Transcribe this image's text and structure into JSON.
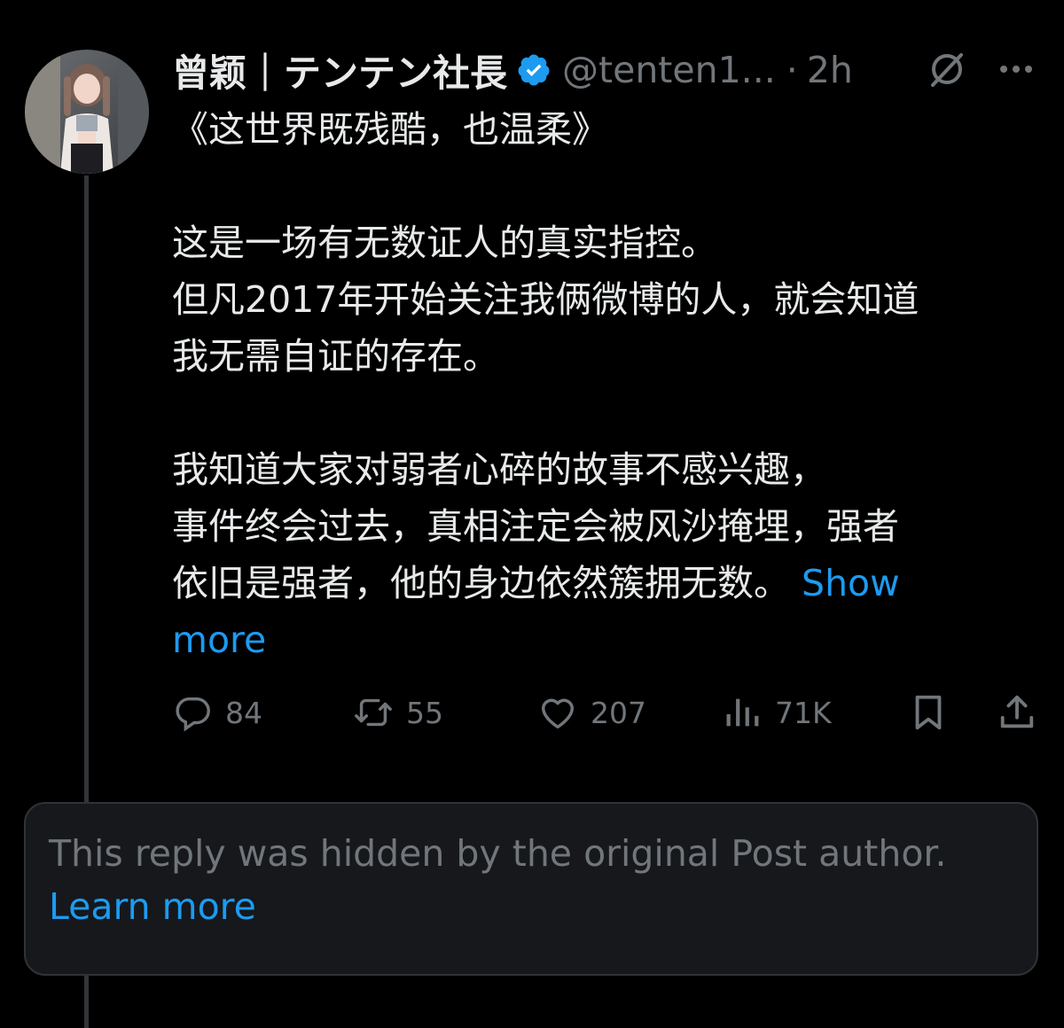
{
  "post": {
    "author": {
      "display_name": "曾颖｜テンテン社長",
      "handle": "@tenten1...",
      "separator": "·",
      "time": "2h",
      "verified": true,
      "avatar": "avatar-photo"
    },
    "body_lines": [
      "《这世界既残酷，也温柔》",
      "",
      "这是一场有无数证人的真实指控。",
      "但凡2017年开始关注我俩微博的人，就会知道",
      "我无需自证的存在。",
      "",
      "我知道大家对弱者心碎的故事不感兴趣，",
      "事件终会过去，真相注定会被风沙掩埋，强者",
      "依旧是强者，他的身边依然簇拥无数。"
    ],
    "show_more": "Show more",
    "show_more_part1": "Show",
    "show_more_part2": "more",
    "stats": {
      "replies": "84",
      "reposts": "55",
      "likes": "207",
      "views": "71K"
    },
    "icons": {
      "reply": "reply-icon",
      "repost": "repost-icon",
      "like": "heart-icon",
      "views": "views-icon",
      "bookmark": "bookmark-icon",
      "share": "share-icon",
      "grok": "grok-icon",
      "more": "more-icon",
      "verified": "verified-badge-icon"
    }
  },
  "hidden_reply": {
    "message": "This reply was hidden by the original Post author.",
    "learn_more": "Learn more"
  },
  "colors": {
    "background": "#000000",
    "text": "#e7e9ea",
    "muted": "#71767b",
    "accent": "#1d9bf0",
    "card": "#16181c",
    "thread_line": "#333639"
  }
}
